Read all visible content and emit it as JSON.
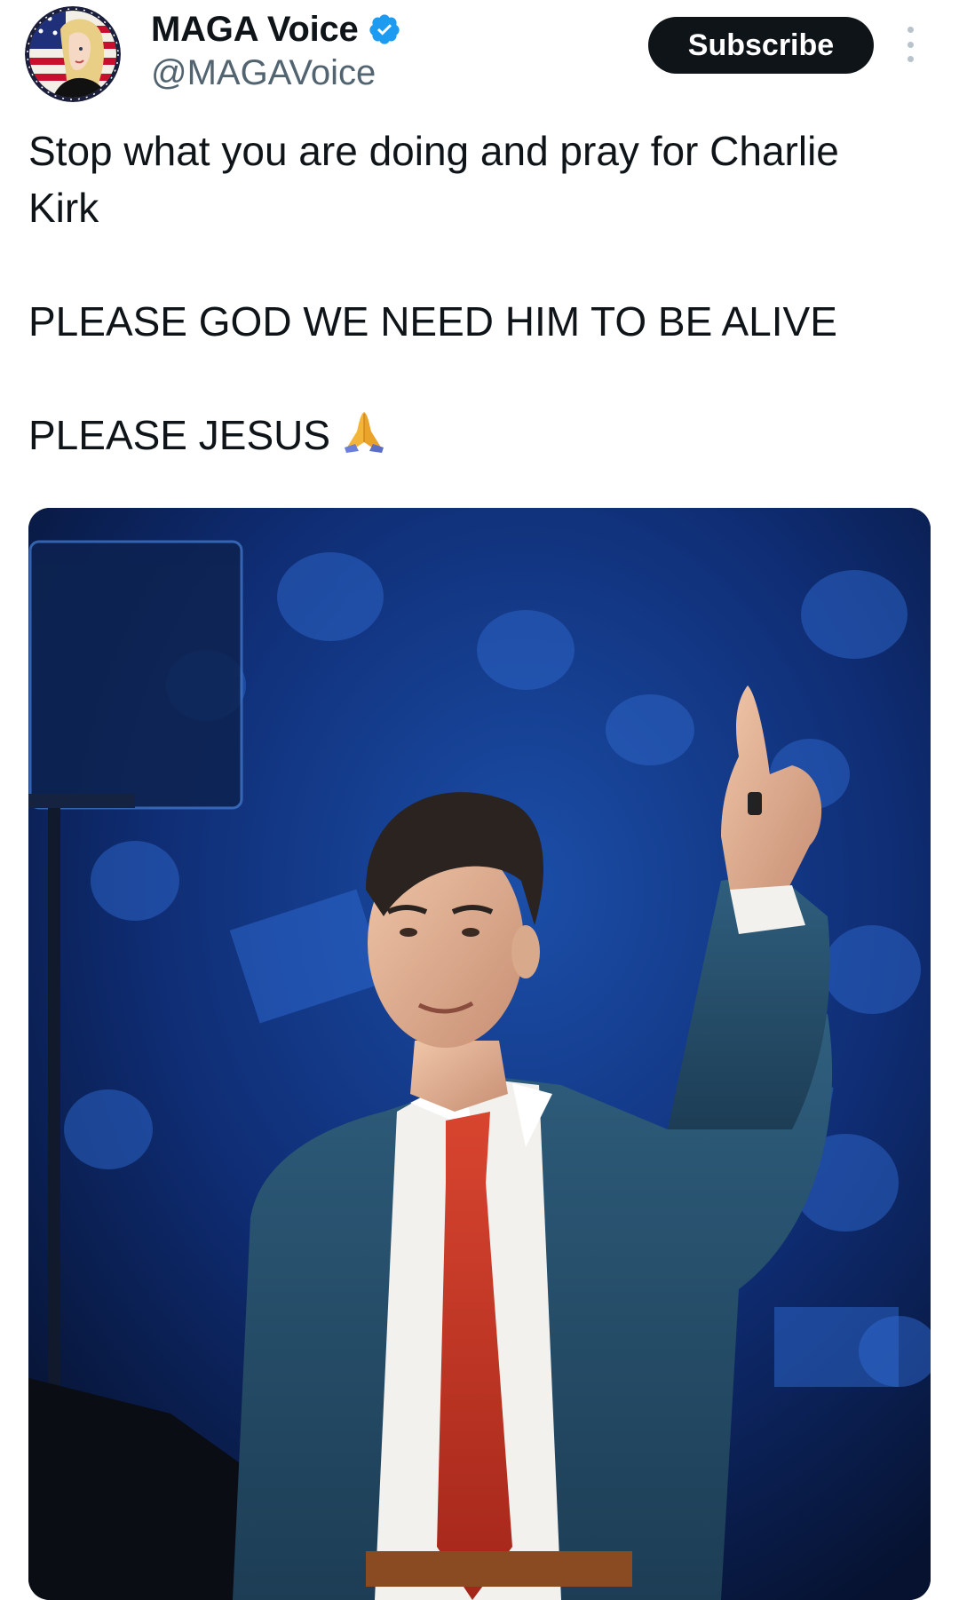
{
  "author": {
    "display_name": "MAGA Voice",
    "handle": "@MAGAVoice",
    "verified": true,
    "avatar_icon": "avatar-image",
    "verified_icon": "verified-badge-icon"
  },
  "actions": {
    "subscribe_label": "Subscribe",
    "more_icon": "more-options-icon"
  },
  "tweet": {
    "lines": [
      "Stop what you are doing and pray for Charlie",
      "Kirk",
      "PLEASE GOD WE NEED HIM TO BE ALIVE",
      "PLEASE JESUS"
    ],
    "emoji": "praying-hands-icon"
  },
  "media": {
    "type": "photo"
  },
  "colors": {
    "text": "#0f1419",
    "secondary": "#536471",
    "verified": "#1d9bf0",
    "button_bg": "#0f1419"
  }
}
